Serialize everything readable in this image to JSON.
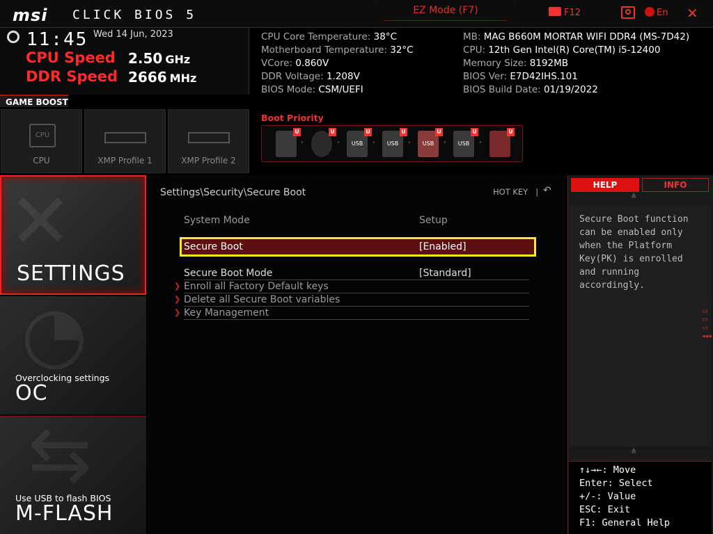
{
  "header": {
    "logo": "msi",
    "product": "CLICK BIOS 5",
    "ez_mode": "EZ Mode (F7)",
    "screenshot_key": "F12",
    "language": "En",
    "close_icon": "close-icon"
  },
  "status": {
    "time": "11:45",
    "date": "Wed  14 Jun, 2023",
    "cpu_speed_label": "CPU Speed",
    "cpu_speed_value": "2.50",
    "cpu_speed_unit": "GHz",
    "ddr_speed_label": "DDR Speed",
    "ddr_speed_value": "2666",
    "ddr_speed_unit": "MHz"
  },
  "sysinfo_left": [
    {
      "k": "CPU Core Temperature: ",
      "v": "38°C"
    },
    {
      "k": "Motherboard Temperature: ",
      "v": "32°C"
    },
    {
      "k": "VCore: ",
      "v": "0.860V"
    },
    {
      "k": "DDR Voltage: ",
      "v": "1.208V"
    },
    {
      "k": "BIOS Mode: ",
      "v": "CSM/UEFI"
    }
  ],
  "sysinfo_right": [
    {
      "k": "MB: ",
      "v": "MAG B660M MORTAR WIFI DDR4 (MS-7D42)"
    },
    {
      "k": "CPU: ",
      "v": "12th Gen Intel(R) Core(TM) i5-12400"
    },
    {
      "k": "Memory Size: ",
      "v": "8192MB"
    },
    {
      "k": "BIOS Ver: ",
      "v": "E7D42IHS.101"
    },
    {
      "k": "BIOS Build Date: ",
      "v": "01/19/2022"
    }
  ],
  "game_boost": {
    "label": "GAME BOOST",
    "tiles": [
      {
        "label": "CPU",
        "icon": "cpu-icon"
      },
      {
        "label": "XMP Profile 1",
        "icon": "memory-icon"
      },
      {
        "label": "XMP Profile 2",
        "icon": "memory-icon"
      }
    ]
  },
  "boot_priority": {
    "label": "Boot Priority",
    "devices": [
      {
        "icon": "hdd-icon",
        "text": ""
      },
      {
        "icon": "optical-disc-icon",
        "text": ""
      },
      {
        "icon": "usb-hdd-icon",
        "text": "USB"
      },
      {
        "icon": "usb-optical-icon",
        "text": "USB"
      },
      {
        "icon": "usb-key-icon",
        "text": "USB"
      },
      {
        "icon": "usb-floppy-icon",
        "text": "USB"
      },
      {
        "icon": "network-icon",
        "text": ""
      }
    ],
    "badge": "U"
  },
  "nav": {
    "settings": {
      "title": "SETTINGS",
      "sub": ""
    },
    "oc": {
      "title": "OC",
      "sub": "Overclocking settings"
    },
    "mflash": {
      "title": "M-FLASH",
      "sub": "Use USB to flash BIOS"
    }
  },
  "main": {
    "breadcrumb": "Settings\\Security\\Secure Boot",
    "hotkey": "HOT KEY",
    "hotkey_sep": "|",
    "rows": [
      {
        "label": "System Mode",
        "value": "Setup"
      },
      {
        "label": "Secure Boot",
        "value": "[Enabled]"
      },
      {
        "label": "Secure Boot Mode",
        "value": "[Standard]"
      }
    ],
    "submenus": [
      "Enroll all Factory Default keys",
      "Delete all Secure Boot variables",
      "Key Management"
    ]
  },
  "help": {
    "tab_help": "HELP",
    "tab_info": "INFO",
    "text": "Secure Boot function can be enabled only when the Platform Key(PK) is enrolled and running accordingly.",
    "keys": [
      "↑↓→←: Move",
      "Enter: Select",
      "+/-: Value",
      "ESC: Exit",
      "F1: General Help"
    ]
  }
}
